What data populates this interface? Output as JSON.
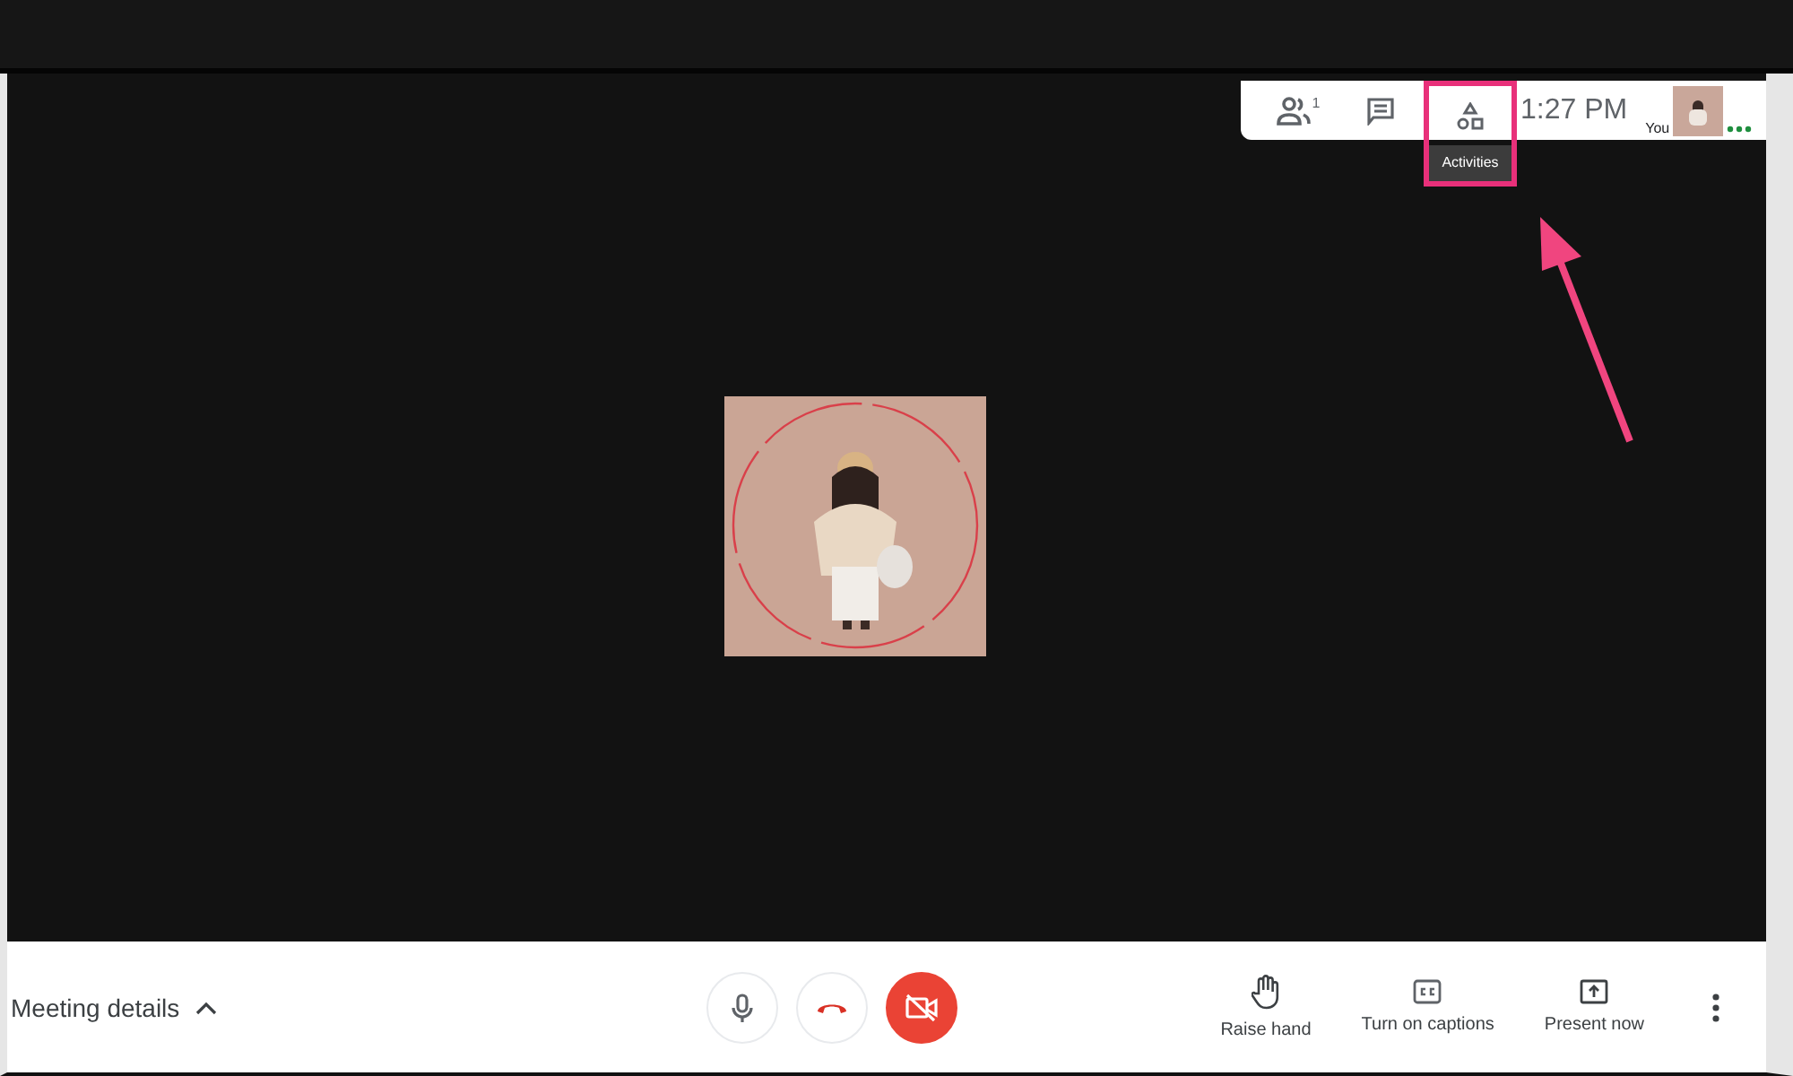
{
  "top_bar": {
    "buttons": [
      {
        "kind": "people",
        "badge": "1",
        "highlighted": false
      },
      {
        "kind": "chat",
        "highlighted": false
      },
      {
        "kind": "activities",
        "highlighted": true,
        "tooltip": "Activities"
      }
    ],
    "time": "1:27 PM",
    "self_label": "You"
  },
  "bottom_bar": {
    "meeting_details": "Meeting details",
    "controls": [
      {
        "kind": "mic",
        "on": true
      },
      {
        "kind": "hangup"
      },
      {
        "kind": "camera",
        "on": false
      }
    ],
    "actions": [
      {
        "kind": "hand",
        "label": "Raise hand"
      },
      {
        "kind": "captions",
        "label": "Turn on captions"
      },
      {
        "kind": "present",
        "label": "Present now"
      }
    ]
  }
}
